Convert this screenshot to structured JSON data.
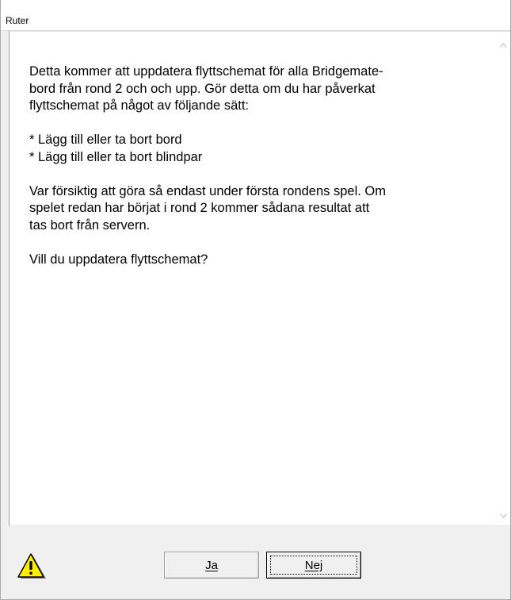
{
  "window": {
    "title": "Ruter"
  },
  "message": {
    "paragraph1_line1": "Detta kommer att uppdatera flyttschemat för alla Bridgemate-",
    "paragraph1_line2": "bord från rond 2 och och upp. Gör detta om du har påverkat",
    "paragraph1_line3": "flyttschemat på något av följande sätt:",
    "bullet1": "* Lägg till eller ta bort bord",
    "bullet2": "* Lägg till eller ta bort blindpar",
    "paragraph2_line1": "Var försiktig att göra så endast under första rondens spel. Om",
    "paragraph2_line2": "spelet redan har börjat i rond 2 kommer sådana resultat att",
    "paragraph2_line3": "tas bort från servern.",
    "question": "Vill du uppdatera flyttschemat?"
  },
  "buttons": {
    "yes_label": "Ja",
    "no_label": "Nej"
  },
  "icons": {
    "warning": "warning-icon"
  },
  "colors": {
    "warning_fill": "#ffee00",
    "window_bg": "#f0f0f0",
    "content_bg": "#ffffff"
  }
}
